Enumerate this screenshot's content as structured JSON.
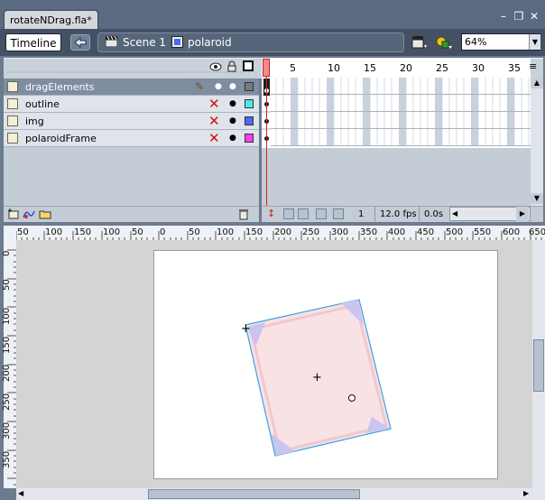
{
  "document": {
    "tab_title": "rotateNDrag.fla*"
  },
  "edit_bar": {
    "timeline_button": "Timeline",
    "breadcrumbs": [
      "Scene 1",
      "polaroid"
    ],
    "zoom": "64%"
  },
  "timeline": {
    "frame_numbers": [
      "1",
      "5",
      "10",
      "15",
      "20",
      "25",
      "30",
      "35"
    ],
    "layers": [
      {
        "name": "dragElements",
        "color": "#7a7a7a",
        "selected": true,
        "locked": false
      },
      {
        "name": "outline",
        "color": "#4ee8e8",
        "selected": false,
        "locked": true
      },
      {
        "name": "img",
        "color": "#4a6cf0",
        "selected": false,
        "locked": true
      },
      {
        "name": "polaroidFrame",
        "color": "#ff3cf0",
        "selected": false,
        "locked": true
      }
    ],
    "status": {
      "current_frame": "1",
      "fps": "12.0 fps",
      "time": "0.0s"
    }
  },
  "rulers": {
    "top_labels": [
      "50",
      "100",
      "150",
      "100",
      "50",
      "0",
      "50",
      "100",
      "150",
      "200",
      "250",
      "300",
      "350",
      "400",
      "450",
      "500",
      "550",
      "600",
      "650"
    ],
    "left_labels": [
      "0",
      "50",
      "100",
      "150",
      "200",
      "250",
      "300",
      "350"
    ]
  },
  "colors": {
    "accent": "#5a6a80",
    "stage_bg": "#ffffff",
    "pasteboard": "#d4d4d4"
  },
  "icons": {
    "back": "arrow-left-icon",
    "scene": "clapper-icon",
    "symbol": "symbol-icon",
    "edit_scene": "edit-scene-icon",
    "edit_symbol": "edit-symbol-icon"
  }
}
